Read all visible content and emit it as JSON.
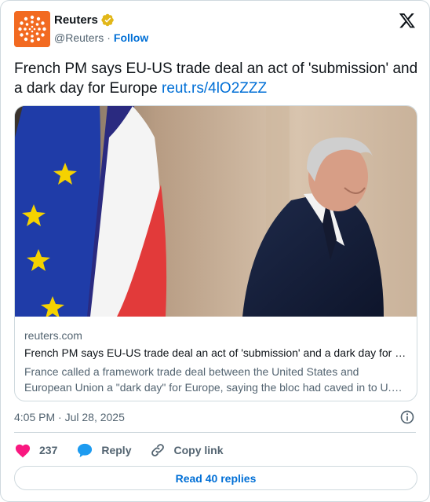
{
  "author": {
    "name": "Reuters",
    "handle": "@Reuters",
    "separator": "·",
    "follow_label": "Follow",
    "avatar_icon": "reuters-logo-icon",
    "verified_icon": "verified-badge-icon",
    "brand_color": "#f26a21"
  },
  "tweet": {
    "text": "French PM says EU-US trade deal an act of 'submission' and a dark day for Europe ",
    "link": "reut.rs/4lO2ZZZ"
  },
  "link_card": {
    "domain": "reuters.com",
    "title": "French PM says EU-US trade deal an act of 'submission' and a dark day for Europe",
    "description": "France called a framework trade deal between the United States and European Union a \"dark day\" for Europe, saying the bloc had caved in to U.S. pressure."
  },
  "meta": {
    "timestamp": "4:05 PM · Jul 28, 2025",
    "info_icon": "info-icon"
  },
  "actions": {
    "like_count": "237",
    "reply_label": "Reply",
    "copy_label": "Copy link"
  },
  "replies_label": "Read 40 replies",
  "colors": {
    "link": "#006fd6",
    "like": "#f91880",
    "reply_icon": "#1d9bf0",
    "muted": "#536471"
  }
}
